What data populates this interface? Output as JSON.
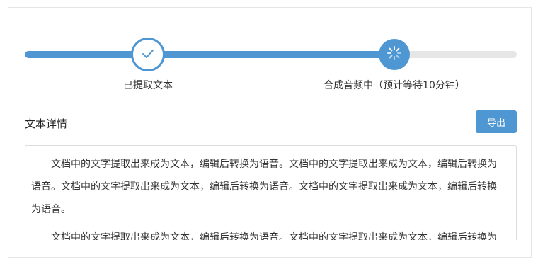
{
  "progress": {
    "fraction": 0.72,
    "steps": [
      {
        "label": "已提取文本",
        "state": "done",
        "icon": "check-icon"
      },
      {
        "label": "合成音频中（预计等待10分钟）",
        "state": "active",
        "icon": "spinner-icon"
      }
    ]
  },
  "detail": {
    "title": "文本详情",
    "export_label": "导出",
    "paragraphs": [
      "文档中的文字提取出来成为文本，编辑后转换为语音。文档中的文字提取出来成为文本，编辑后转换为语音。文档中的文字提取出来成为文本，编辑后转换为语音。文档中的文字提取出来成为文本，编辑后转换为语音。",
      "文档中的文字提取出来成为文本，编辑后转换为语音。文档中的文字提取出来成为文本，编辑后转换为语音。"
    ]
  },
  "colors": {
    "accent": "#4f97d3",
    "track": "#e6e6e6"
  }
}
